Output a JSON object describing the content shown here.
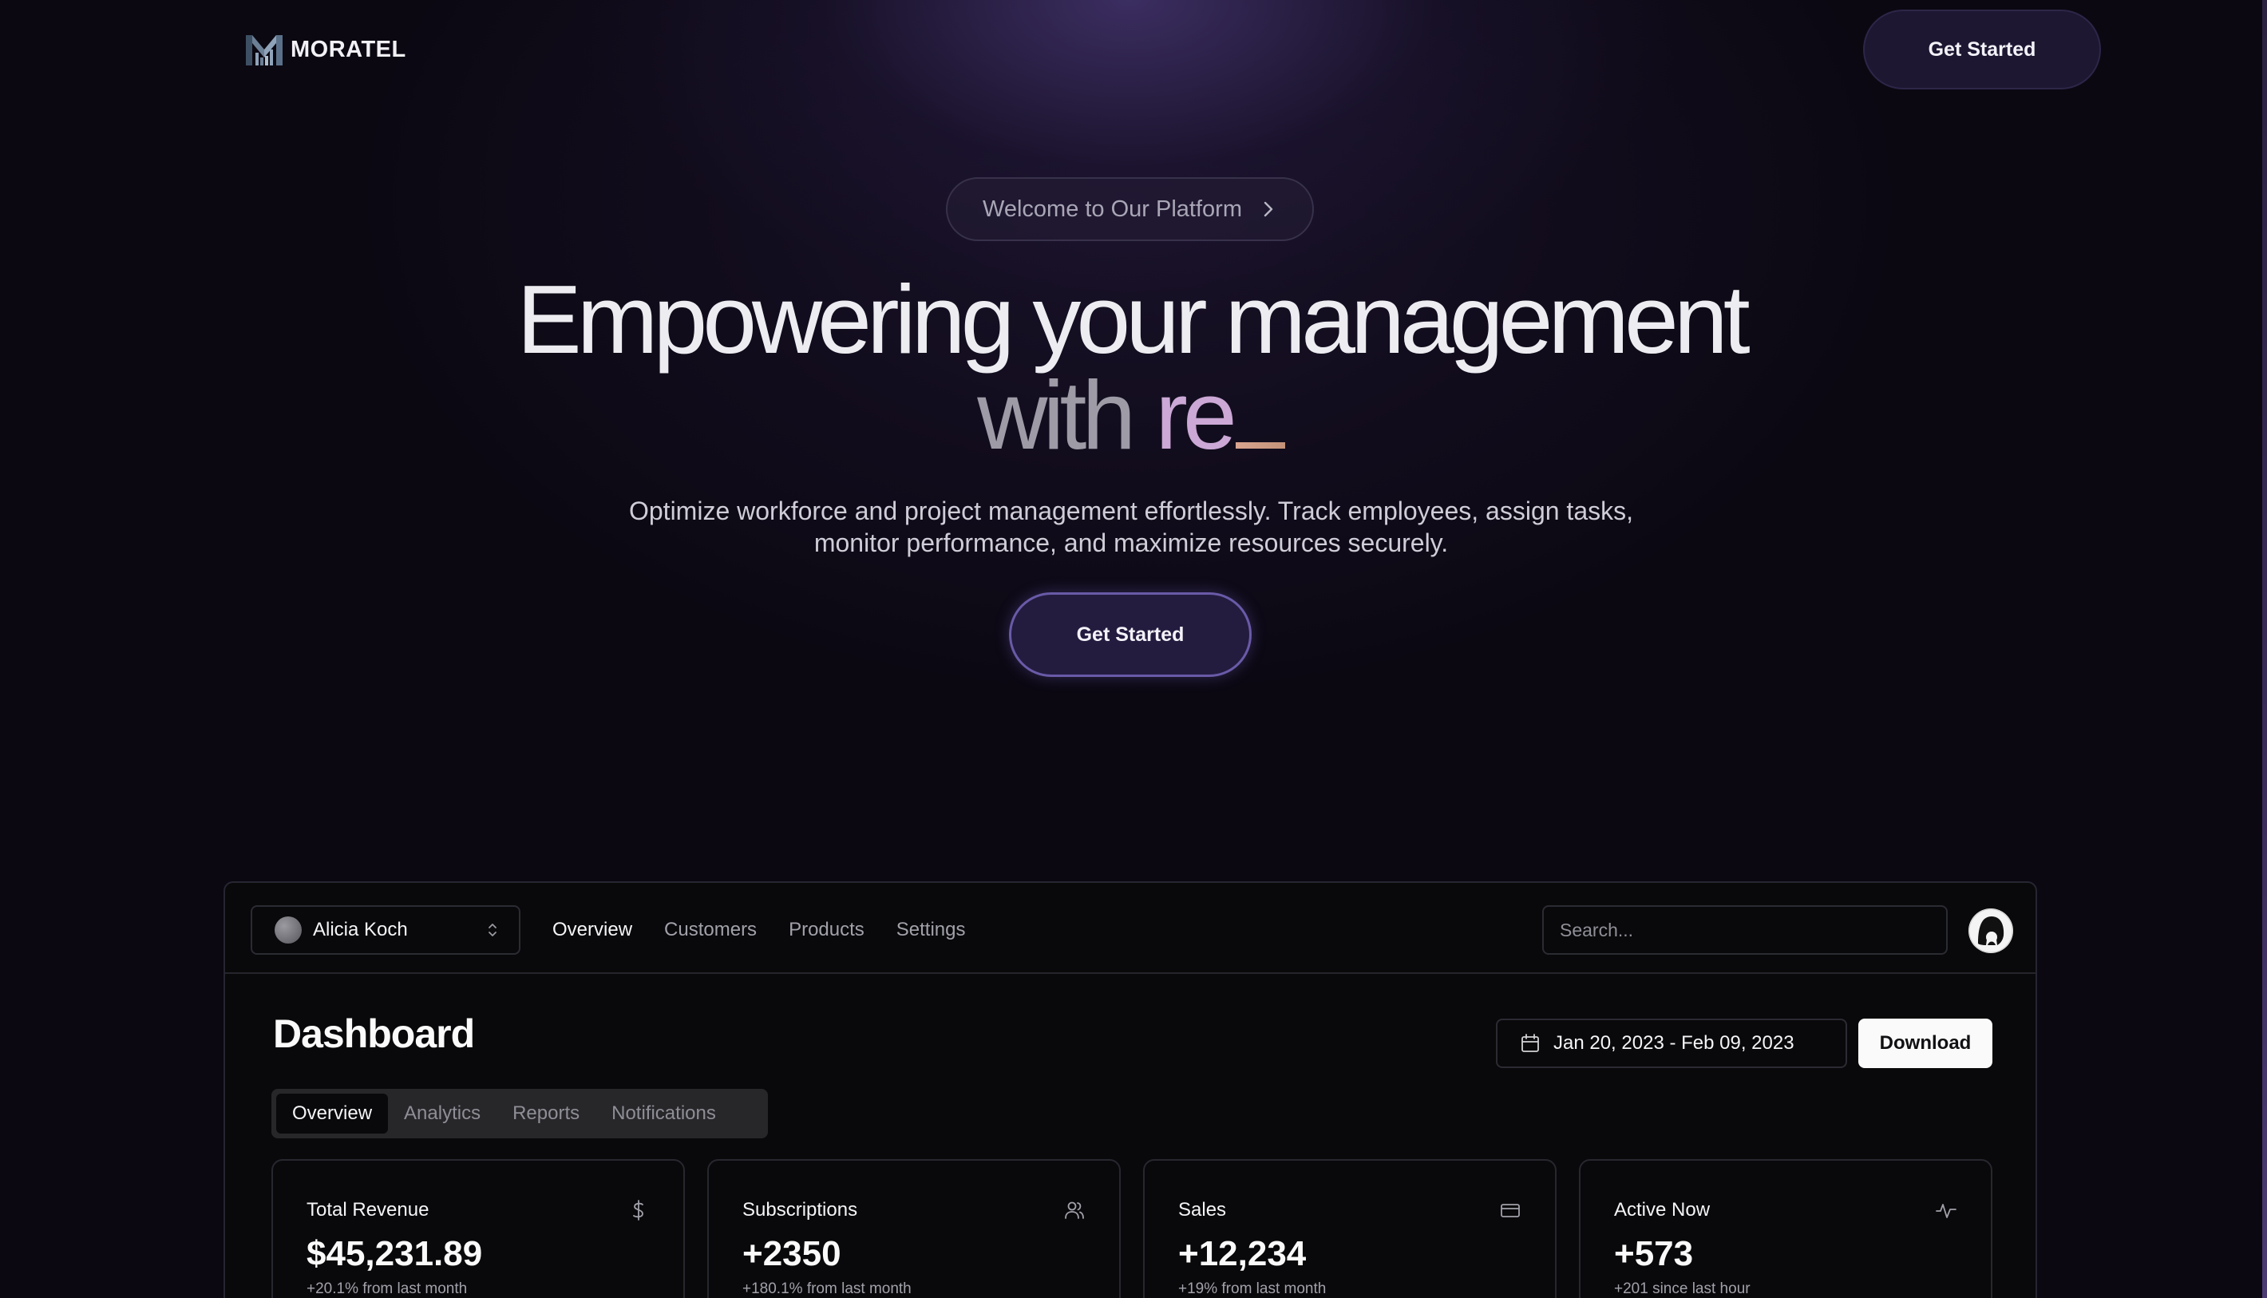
{
  "brand": {
    "name": "MORATEL"
  },
  "header": {
    "cta_label": "Get Started"
  },
  "hero": {
    "badge_label": "Welcome to Our Platform",
    "title_line1": "Empowering your management",
    "title_with": "with",
    "title_typed": "re",
    "subtitle_line1": "Optimize workforce and project management effortlessly. Track employees, assign tasks,",
    "subtitle_line2": "monitor performance, and maximize resources securely.",
    "cta_label": "Get Started"
  },
  "dashboard": {
    "team_name": "Alicia Koch",
    "nav": [
      "Overview",
      "Customers",
      "Products",
      "Settings"
    ],
    "search_placeholder": "Search...",
    "title": "Dashboard",
    "date_range": "Jan 20, 2023 - Feb 09, 2023",
    "download_label": "Download",
    "tabs": [
      "Overview",
      "Analytics",
      "Reports",
      "Notifications"
    ],
    "cards": [
      {
        "title": "Total Revenue",
        "value": "$45,231.89",
        "note": "+20.1% from last month",
        "icon": "dollar-icon"
      },
      {
        "title": "Subscriptions",
        "value": "+2350",
        "note": "+180.1% from last month",
        "icon": "users-icon"
      },
      {
        "title": "Sales",
        "value": "+12,234",
        "note": "+19% from last month",
        "icon": "credit-card-icon"
      },
      {
        "title": "Active Now",
        "value": "+573",
        "note": "+201 since last hour",
        "icon": "activity-icon"
      }
    ]
  },
  "colors": {
    "background": "#0b0812",
    "accent": "#6a5aa8",
    "typed_text": "#cba8d6",
    "cursor": "#d9a58f"
  }
}
